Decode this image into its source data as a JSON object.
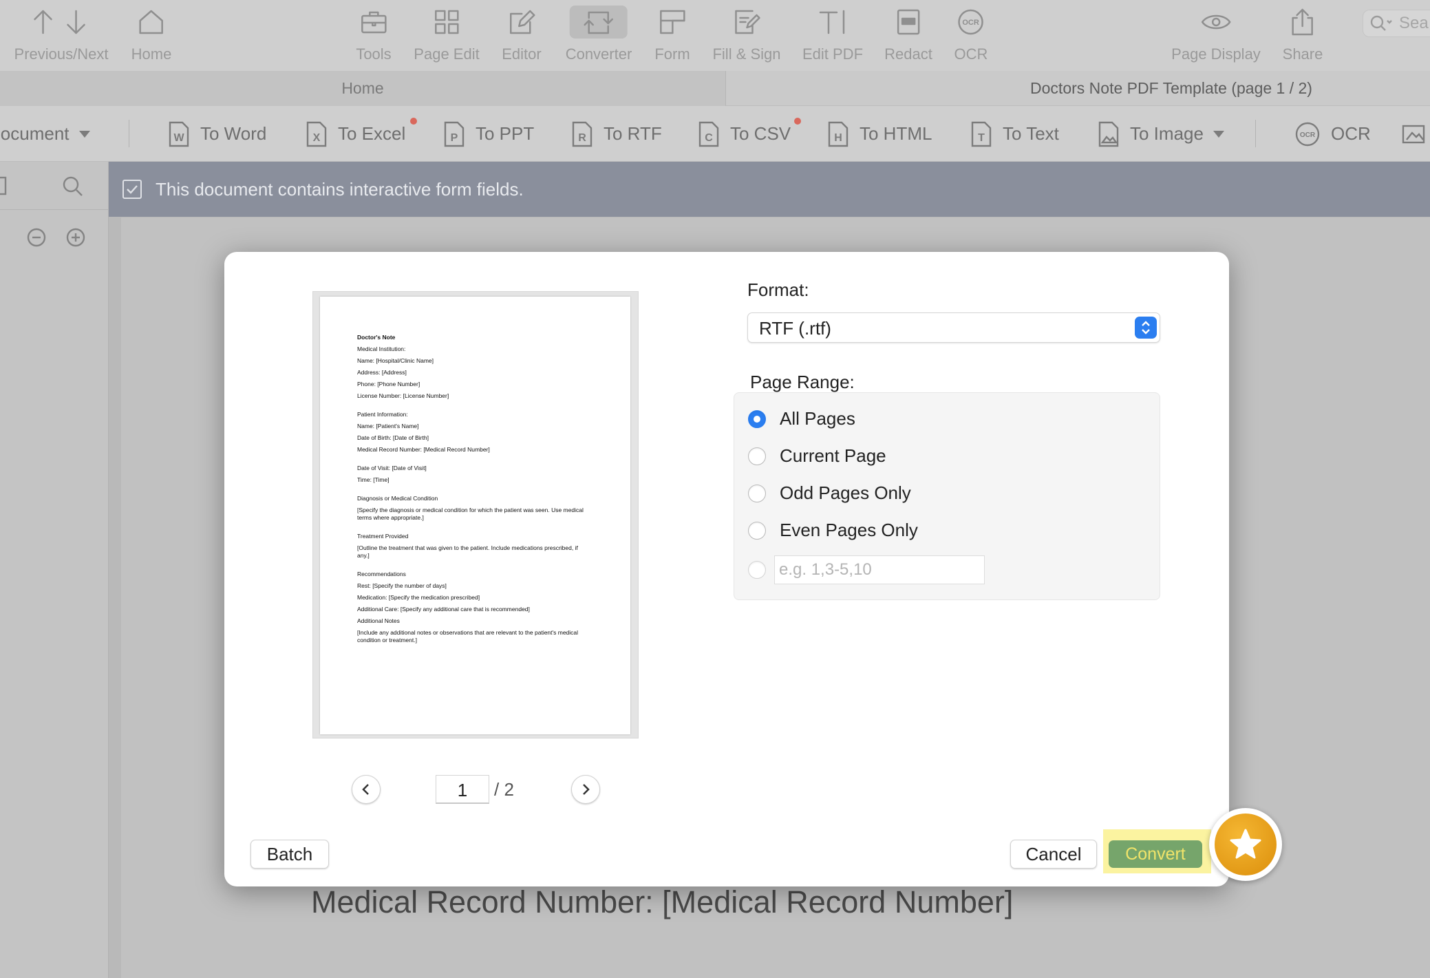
{
  "toolbar": {
    "items": [
      {
        "label": "Previous/Next",
        "icon": "arrow-up-down-icon"
      },
      {
        "label": "Home",
        "icon": "home-icon"
      },
      {
        "label": "Tools",
        "icon": "toolbox-icon"
      },
      {
        "label": "Page Edit",
        "icon": "grid-icon"
      },
      {
        "label": "Editor",
        "icon": "pencil-square-icon"
      },
      {
        "label": "Converter",
        "icon": "convert-icon"
      },
      {
        "label": "Form",
        "icon": "form-icon"
      },
      {
        "label": "Fill & Sign",
        "icon": "signature-icon"
      },
      {
        "label": "Edit PDF",
        "icon": "text-cursor-icon"
      },
      {
        "label": "Redact",
        "icon": "redact-icon"
      },
      {
        "label": "OCR",
        "icon": "ocr-icon"
      },
      {
        "label": "Page Display",
        "icon": "eye-icon"
      },
      {
        "label": "Share",
        "icon": "share-icon"
      }
    ],
    "search_label": "Sea"
  },
  "tabs": {
    "home": "Home",
    "document": "Doctors Note PDF Template (page 1 / 2)"
  },
  "converter_bar": {
    "document_label": "Document",
    "items": [
      {
        "label": "To Word",
        "letter": "W"
      },
      {
        "label": "To Excel",
        "letter": "X"
      },
      {
        "label": "To PPT",
        "letter": "P"
      },
      {
        "label": "To RTF",
        "letter": "R"
      },
      {
        "label": "To CSV",
        "letter": "C"
      },
      {
        "label": "To HTML",
        "letter": "H"
      },
      {
        "label": "To Text",
        "letter": "T"
      },
      {
        "label": "To Image",
        "letter": ""
      },
      {
        "label": "OCR",
        "letter": "OCR"
      }
    ]
  },
  "notice": {
    "text": "This document contains interactive form fields."
  },
  "document_visible_text": "Medical Record Number: [Medical Record Number]",
  "preview": {
    "title": "Doctor's Note",
    "lines": [
      "Medical Institution:",
      "Name: [Hospital/Clinic Name]",
      "Address: [Address]",
      "Phone: [Phone Number]",
      "License Number: [License Number]",
      "Patient Information:",
      "Name: [Patient's Name]",
      "Date of Birth: [Date of Birth]",
      "Medical Record Number: [Medical Record Number]",
      "Date of Visit: [Date of Visit]",
      "Time: [Time]",
      "Diagnosis or Medical Condition",
      "[Specify the diagnosis or medical condition for which the patient was seen. Use medical terms where appropriate.]",
      "Treatment Provided",
      "[Outline the treatment that was given to the patient. Include medications prescribed, if any.]",
      "Recommendations",
      "Rest: [Specify the number of days]",
      "Medication: [Specify the medication prescribed]",
      "Additional Care: [Specify any additional care that is recommended]",
      "Additional Notes",
      "[Include any additional notes or observations that are relevant to the patient's medical condition or treatment.]"
    ],
    "current_page": "1",
    "total_pages": "/ 2"
  },
  "dialog": {
    "format_label": "Format:",
    "format_value": "RTF (.rtf)",
    "page_range_label": "Page Range:",
    "options": [
      "All Pages",
      "Current Page",
      "Odd Pages Only",
      "Even Pages Only"
    ],
    "selected_option": "All Pages",
    "custom_range_placeholder": "e.g. 1,3-5,10",
    "batch_label": "Batch",
    "cancel_label": "Cancel",
    "convert_label": "Convert"
  },
  "colors": {
    "accent": "#2b7ef0",
    "convert_button": "#76a56b",
    "highlight": "#fbf3a0",
    "badge": "#e9a21c"
  }
}
